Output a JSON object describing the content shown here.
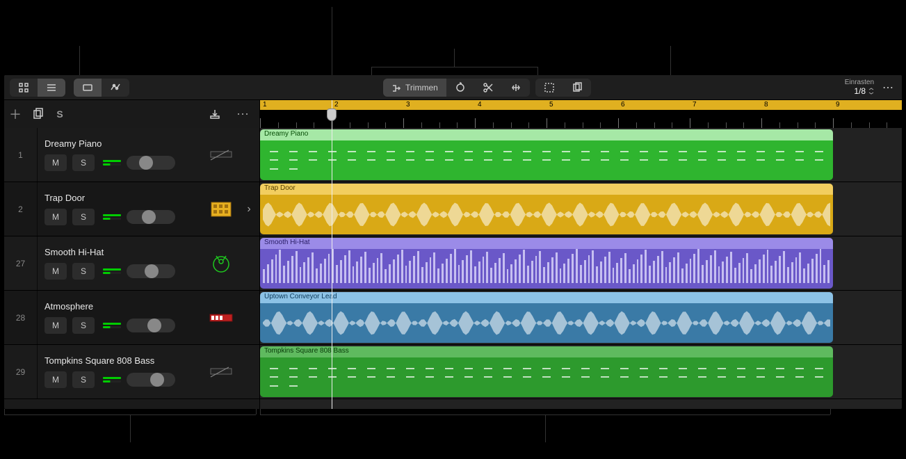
{
  "toolbar": {
    "trim_label": "Trimmen",
    "snap_label": "Einrasten",
    "snap_value": "1/8"
  },
  "header": {
    "solo_char": "S"
  },
  "ruler": {
    "bars": [
      "1",
      "2",
      "3",
      "4",
      "5",
      "6",
      "7",
      "8",
      "9"
    ]
  },
  "tracks": [
    {
      "num": "1",
      "name": "Dreamy Piano",
      "mute": "M",
      "solo": "S",
      "icon": "keys",
      "expandable": false,
      "region": {
        "label": "Dreamy Piano",
        "color": "green",
        "type": "midi"
      }
    },
    {
      "num": "2",
      "name": "Trap Door",
      "mute": "M",
      "solo": "S",
      "icon": "drum-machine",
      "expandable": true,
      "region": {
        "label": "Trap Door",
        "color": "yellow",
        "type": "audio"
      }
    },
    {
      "num": "27",
      "name": "Smooth Hi-Hat",
      "mute": "M",
      "solo": "S",
      "icon": "drummer",
      "expandable": false,
      "region": {
        "label": "Smooth Hi-Hat",
        "color": "purple",
        "type": "hihat"
      }
    },
    {
      "num": "28",
      "name": "Atmosphere",
      "mute": "M",
      "solo": "S",
      "icon": "synth",
      "expandable": false,
      "region": {
        "label": "Uptown Conveyor Lead",
        "color": "blue",
        "type": "audio"
      }
    },
    {
      "num": "29",
      "name": "Tompkins Square 808 Bass",
      "mute": "M",
      "solo": "S",
      "icon": "keys",
      "expandable": false,
      "region": {
        "label": "Tompkins Square 808 Bass",
        "color": "green2",
        "type": "midi"
      }
    }
  ],
  "playhead_bar": 2,
  "colors": {
    "green": "#2fb52f",
    "yellow": "#d9a916",
    "purple": "#6a58c8",
    "blue": "#3a7aa6"
  }
}
